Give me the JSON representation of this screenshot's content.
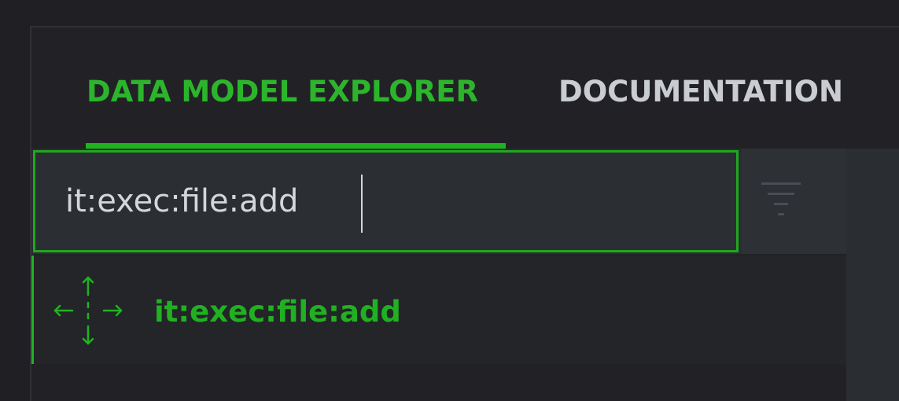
{
  "tabs": {
    "active_label": "DATA MODEL EXPLORER",
    "inactive_label": "DOCUMENTATION"
  },
  "search": {
    "value": "it:exec:file:add",
    "placeholder": ""
  },
  "results": [
    {
      "label": "it:exec:file:add",
      "icon": "move-arrows-icon"
    }
  ],
  "colors": {
    "accent": "#1fb31f",
    "background": "#202024",
    "tab_inactive": "#c9ccd1"
  }
}
